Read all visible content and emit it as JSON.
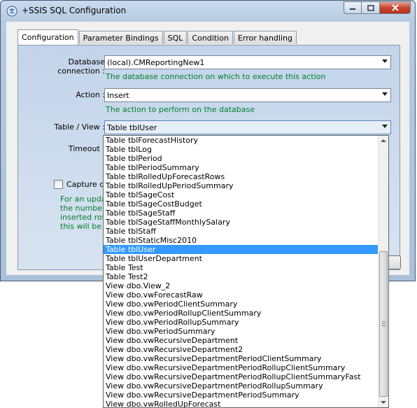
{
  "window": {
    "title": "+SSIS SQL Configuration"
  },
  "tabs": [
    "Configuration",
    "Parameter Bindings",
    "SQL",
    "Condition",
    "Error handling"
  ],
  "form": {
    "database_connection_label": "Database connection :",
    "database_connection_value": "(local).CMReportingNew1",
    "database_connection_help": "The database connection on which to execute this action",
    "action_label": "Action :",
    "action_value": "Insert",
    "action_help": "The action to perform on the database",
    "table_view_label": "Table / View :",
    "table_view_value": "Table tblUser",
    "timeout_label": "Timeout :",
    "capture_label_partial": "Capture qu",
    "note_lines_partial": [
      "For an updat",
      "the number o",
      "inserted row",
      "this will be th"
    ]
  },
  "dropdown": {
    "selected_index": 12,
    "items": [
      "Table tblForecastHistory",
      "Table tblLog",
      "Table tblPeriod",
      "Table tblPeriodSummary",
      "Table tblRolledUpForecastRows",
      "Table tblRolledUpPeriodSummary",
      "Table tblSageCost",
      "Table tblSageCostBudget",
      "Table tblSageStaff",
      "Table tblSageStaffMonthlySalary",
      "Table tblStaff",
      "Table tblStaticMisc2010",
      "Table tblUser",
      "Table tblUserDepartment",
      "Table Test",
      "Table Test2",
      "View dbo.View_2",
      "View dbo.vwForecastRaw",
      "View dbo.vwPeriodClientSummary",
      "View dbo.vwPeriodRollupClientSummary",
      "View dbo.vwPeriodRollupSummary",
      "View dbo.vwPeriodSummary",
      "View dbo.vwRecursiveDepartment",
      "View dbo.vwRecursiveDepartment2",
      "View dbo.vwRecursiveDepartmentPeriodClientSummary",
      "View dbo.vwRecursiveDepartmentPeriodRollupClientSummary",
      "View dbo.vwRecursiveDepartmentPeriodRollupClientSummaryFast",
      "View dbo.vwRecursiveDepartmentPeriodRollupSummary",
      "View dbo.vwRecursiveDepartmentPeriodSummary",
      "View dbo.vwRolledUpForecast"
    ]
  },
  "icons": {
    "app": "ssis-config-icon",
    "minimize": "minimize-icon",
    "maximize": "maximize-icon",
    "close": "close-icon"
  },
  "colors": {
    "selection": "#3399ff",
    "help_text": "#00802b",
    "close_button": "#c7452f"
  }
}
